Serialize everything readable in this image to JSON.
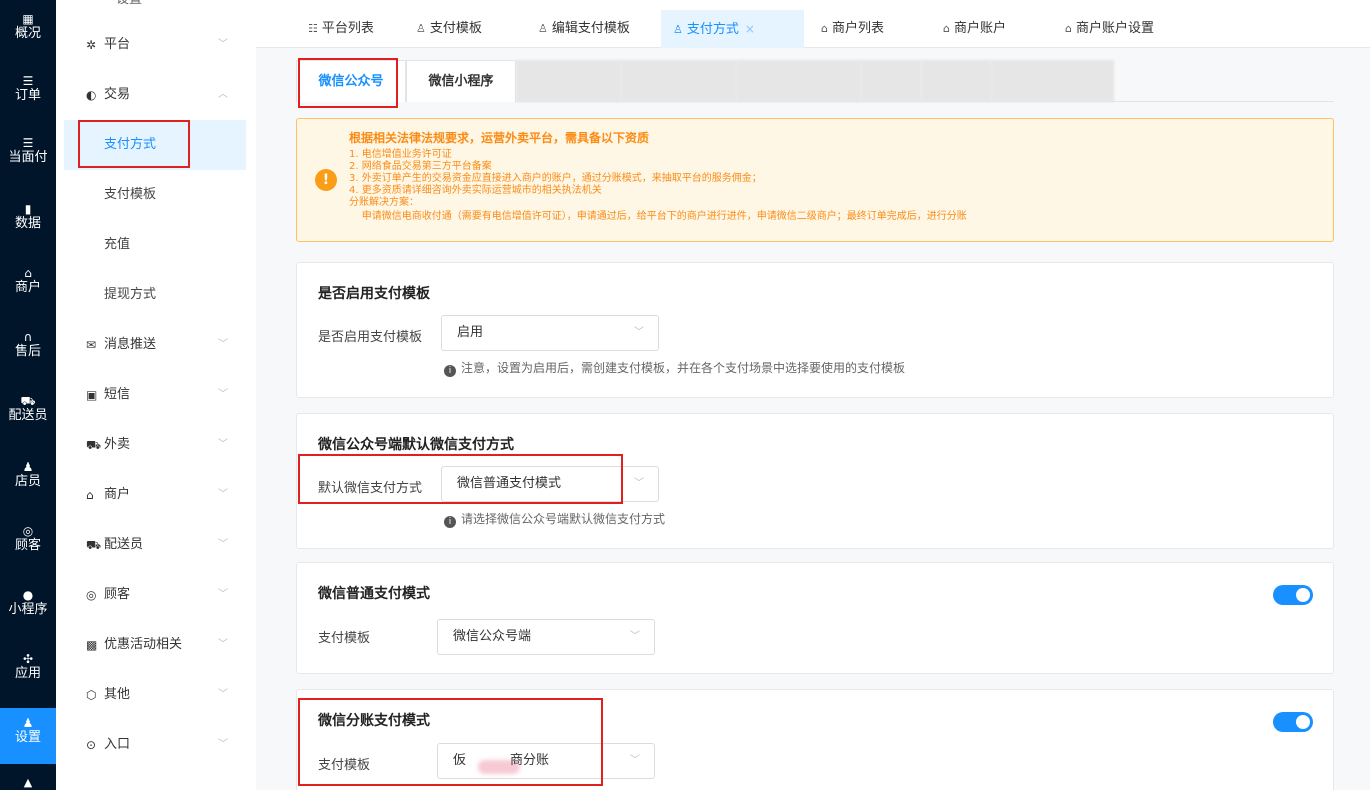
{
  "rail": {
    "items": [
      {
        "label": "设置",
        "icon": "gear-icon",
        "glyph": ""
      },
      {
        "label": "概况",
        "icon": "grid-icon",
        "glyph": "▦"
      },
      {
        "label": "订单",
        "icon": "list-icon",
        "glyph": "☰"
      },
      {
        "label": "当面付",
        "icon": "list-icon",
        "glyph": "☰"
      },
      {
        "label": "数据",
        "icon": "bar-chart-icon",
        "glyph": "▮"
      },
      {
        "label": "商户",
        "icon": "store-icon",
        "glyph": "⌂"
      },
      {
        "label": "售后",
        "icon": "headset-icon",
        "glyph": "∩"
      },
      {
        "label": "配送员",
        "icon": "scooter-icon",
        "glyph": "⛟"
      },
      {
        "label": "店员",
        "icon": "users-icon",
        "glyph": "♟"
      },
      {
        "label": "顾客",
        "icon": "user-circle-icon",
        "glyph": "◎"
      },
      {
        "label": "小程序",
        "icon": "wechat-icon",
        "glyph": "●"
      },
      {
        "label": "应用",
        "icon": "apps-icon",
        "glyph": "✣"
      },
      {
        "label": "设置",
        "icon": "settings-user-icon",
        "glyph": "♟"
      },
      {
        "label": "",
        "icon": "lock-icon",
        "glyph": "🔒"
      }
    ]
  },
  "sidebar": {
    "top_label": "设置",
    "items": [
      {
        "label": "平台",
        "glyph": "✲",
        "chevron": "﹀"
      },
      {
        "label": "交易",
        "glyph": "◐",
        "chevron": "︿"
      },
      {
        "label": "消息推送",
        "glyph": "✉",
        "chevron": "﹀"
      },
      {
        "label": "短信",
        "glyph": "▣",
        "chevron": "﹀"
      },
      {
        "label": "外卖",
        "glyph": "⛟",
        "chevron": "﹀"
      },
      {
        "label": "商户",
        "glyph": "⌂",
        "chevron": "﹀"
      },
      {
        "label": "配送员",
        "glyph": "⛟",
        "chevron": "﹀"
      },
      {
        "label": "顾客",
        "glyph": "◎",
        "chevron": "﹀"
      },
      {
        "label": "优惠活动相关",
        "glyph": "▩",
        "chevron": "﹀"
      },
      {
        "label": "其他",
        "glyph": "⬡",
        "chevron": "﹀"
      },
      {
        "label": "入口",
        "glyph": "⊙",
        "chevron": "﹀"
      }
    ],
    "sub_items": [
      "支付方式",
      "支付模板",
      "充值",
      "提现方式"
    ]
  },
  "tabs": [
    {
      "label": "平台列表",
      "glyph": "☷"
    },
    {
      "label": "支付模板",
      "glyph": "♙"
    },
    {
      "label": "编辑支付模板",
      "glyph": "♙"
    },
    {
      "label": "支付方式",
      "glyph": "♙",
      "close": "×"
    },
    {
      "label": "商户列表",
      "glyph": "⌂"
    },
    {
      "label": "商户账户",
      "glyph": "⌂"
    },
    {
      "label": "商户账户设置",
      "glyph": "⌂"
    }
  ],
  "inner_tabs": [
    "微信公众号",
    "微信小程序"
  ],
  "notice": {
    "title": "根据相关法律法规要求，运营外卖平台，需具备以下资质",
    "lines": [
      "1. 电信增值业务许可证",
      "2. 网络食品交易第三方平台备案",
      "3. 外卖订单产生的交易资金应直接进入商户的账户，通过分账模式，来抽取平台的服务佣金；",
      "4. 更多资质请详细咨询外卖实际运营城市的相关执法机关",
      "分账解决方案：",
      "    申请微信电商收付通（需要有电信增值许可证），申请通过后，给平台下的商户进行进件，申请微信二级商户；最终订单完成后，进行分账"
    ]
  },
  "card1": {
    "title": "是否启用支付模板",
    "label": "是否启用支付模板",
    "value": "启用",
    "hint": "注意，设置为启用后，需创建支付模板，并在各个支付场景中选择要使用的支付模板"
  },
  "card2": {
    "title": "微信公众号端默认微信支付方式",
    "label": "默认微信支付方式",
    "value": "微信普通支付模式",
    "hint": "请选择微信公众号端默认微信支付方式"
  },
  "card3": {
    "title": "微信普通支付模式",
    "label": "支付模板",
    "value": "微信公众号端",
    "toggle_on": true
  },
  "card4": {
    "title": "微信分账支付模式",
    "label": "支付模板",
    "value_left": "仮",
    "value_right": "商分账",
    "toggle_on": true
  },
  "icons": {
    "caret": "﹀",
    "warn": "!",
    "info": "i"
  },
  "colors": {
    "accent": "#1890ff",
    "rail_bg": "#001529",
    "warning": "#fa8c16",
    "highlight_box": "#e02020"
  }
}
